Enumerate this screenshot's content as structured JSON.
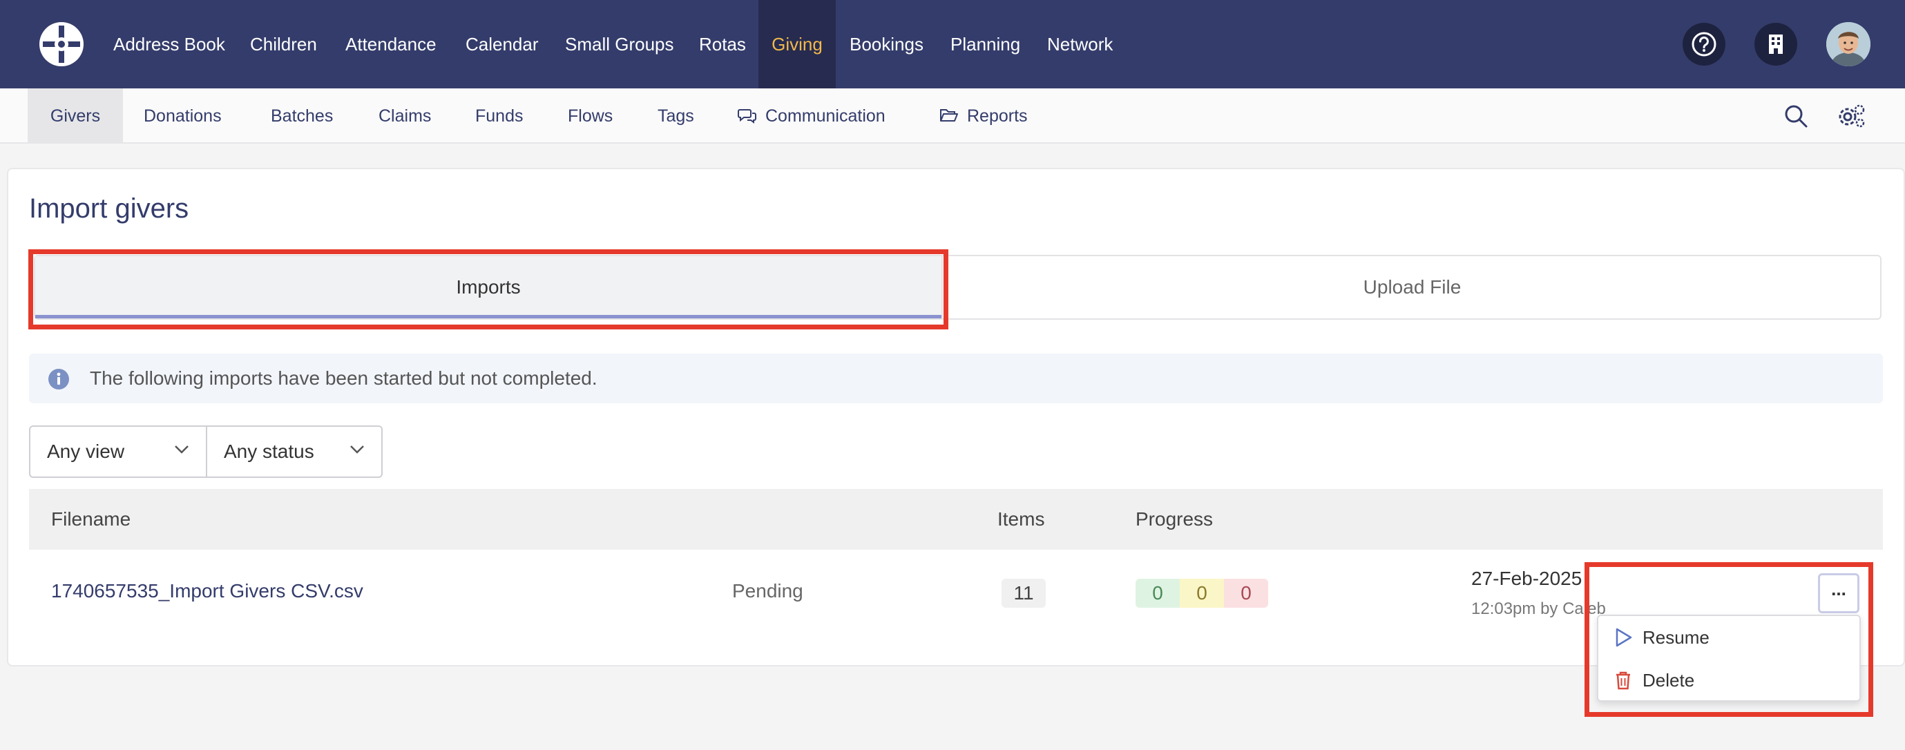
{
  "nav": {
    "items": [
      "Address Book",
      "Children",
      "Attendance",
      "Calendar",
      "Small Groups",
      "Rotas",
      "Giving",
      "Bookings",
      "Planning",
      "Network"
    ],
    "active": "Giving"
  },
  "subnav": {
    "items": [
      "Givers",
      "Donations",
      "Batches",
      "Claims",
      "Funds",
      "Flows",
      "Tags",
      "Communication",
      "Reports"
    ],
    "active": "Givers"
  },
  "page": {
    "title": "Import givers",
    "tabs": [
      "Imports",
      "Upload File"
    ],
    "active_tab": "Imports",
    "info": "The following imports have been started but not completed."
  },
  "filters": {
    "view": "Any view",
    "status": "Any status"
  },
  "table": {
    "headers": {
      "filename": "Filename",
      "items": "Items",
      "progress": "Progress"
    },
    "rows": [
      {
        "filename": "1740657535_Import Givers CSV.csv",
        "status": "Pending",
        "items": "11",
        "progress": {
          "success": "0",
          "warning": "0",
          "error": "0"
        },
        "date": "27-Feb-2025",
        "time_by": "12:03pm by Caleb"
      }
    ]
  },
  "menu": {
    "more_label": "...",
    "items": [
      {
        "label": "Resume",
        "icon": "play-icon"
      },
      {
        "label": "Delete",
        "icon": "trash-icon"
      }
    ]
  },
  "colors": {
    "nav_bg": "#343c6b",
    "accent_active": "#f2b84b",
    "highlight": "#e53a2b",
    "link": "#343c6b"
  }
}
